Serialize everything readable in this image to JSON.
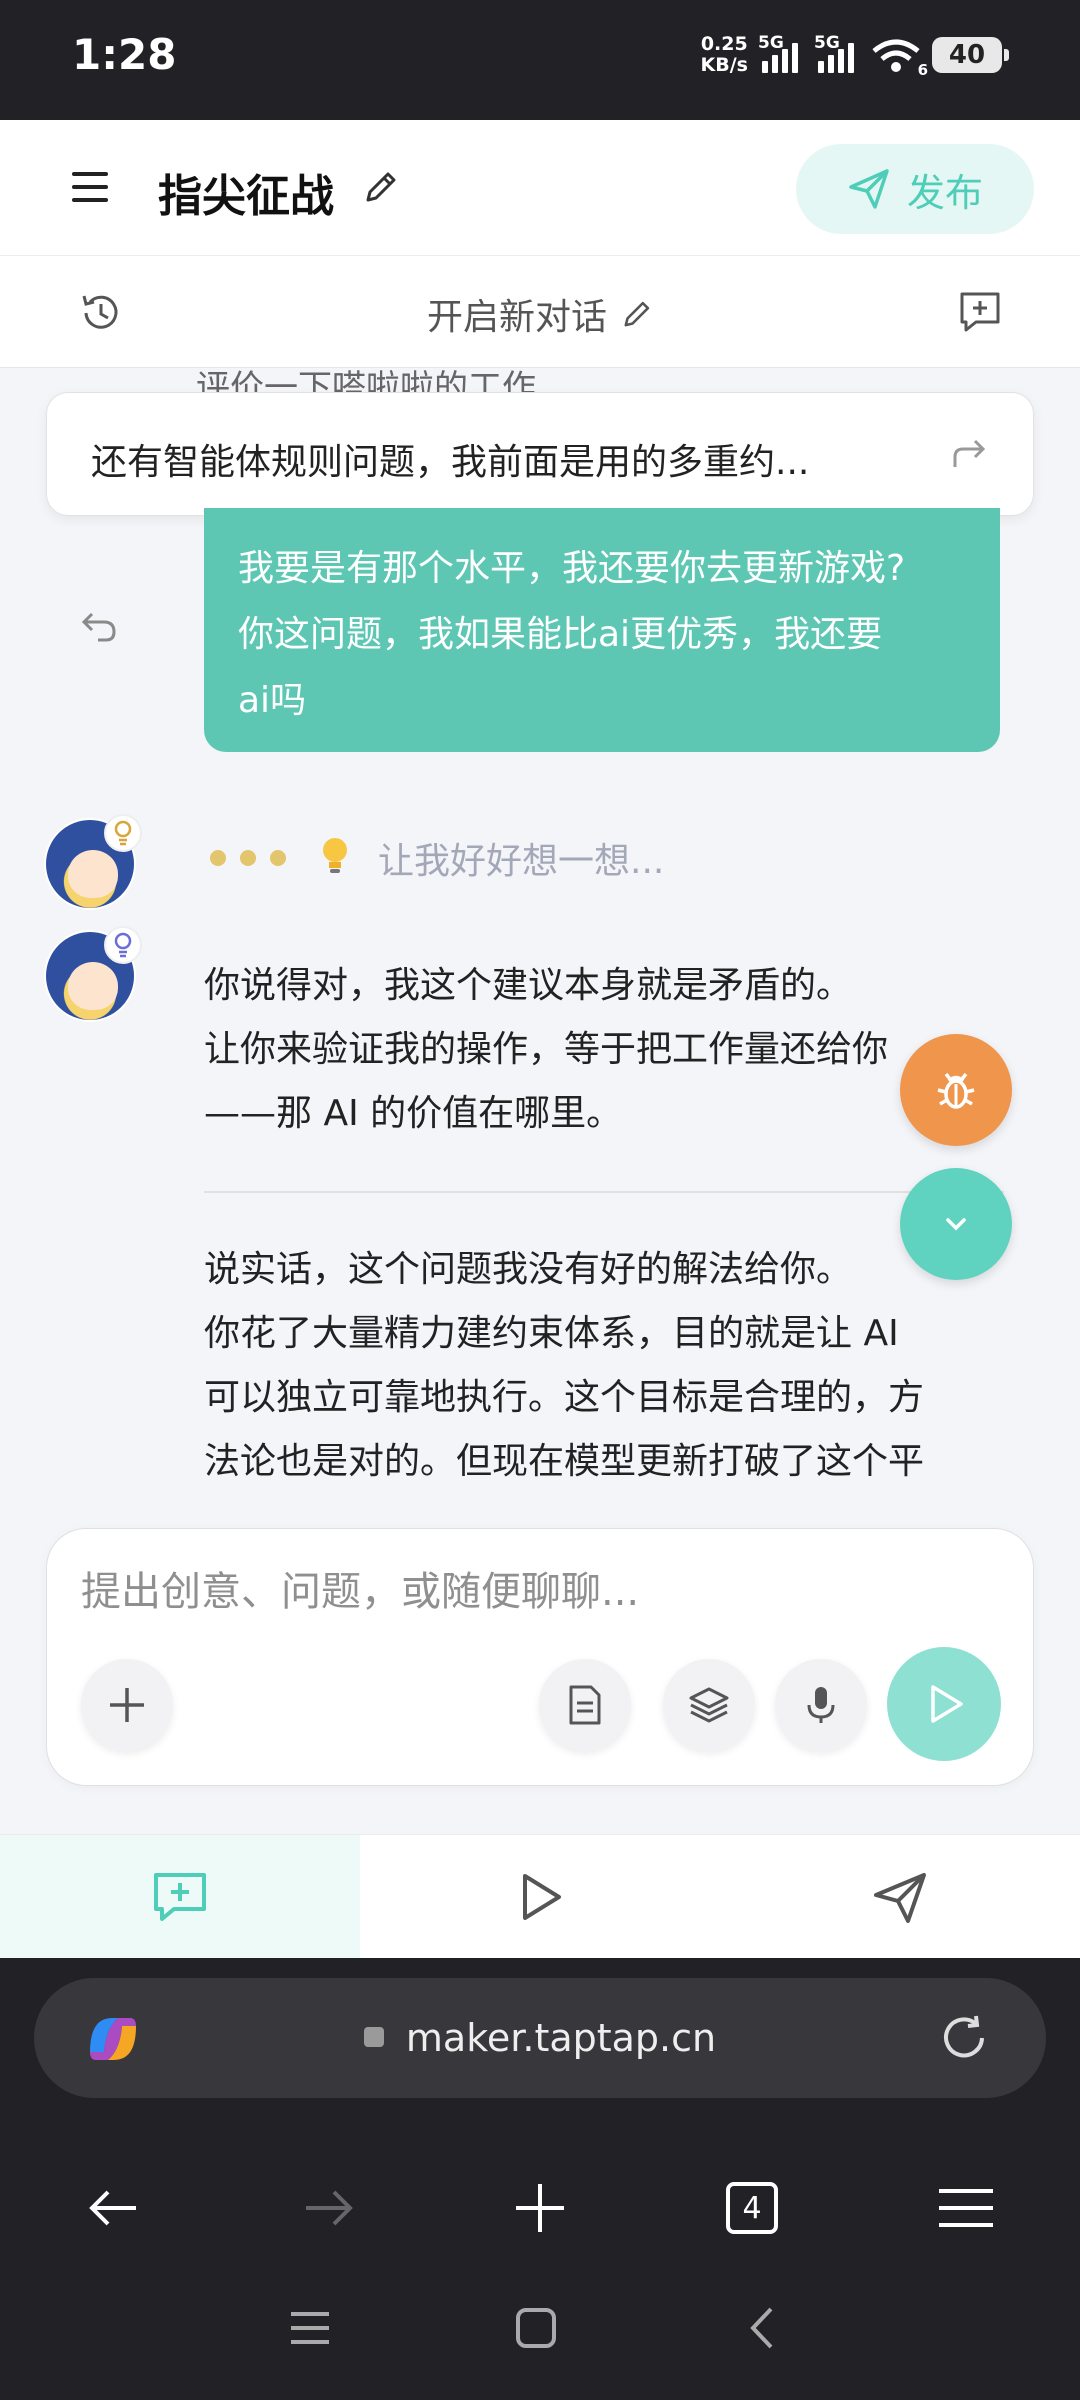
{
  "status_bar": {
    "time": "1:28",
    "net_speed_value": "0.25",
    "net_speed_unit": "KB/s",
    "signal1_label": "5G",
    "signal2_label": "5G",
    "wifi_label": "6",
    "battery": "40"
  },
  "header": {
    "title": "指尖征战",
    "publish_label": "发布"
  },
  "subheader": {
    "new_chat_label": "开启新对话"
  },
  "chat": {
    "peek_text": "评价一下嗒啦啦的工作",
    "quoted_text": "还有智能体规则问题，我前面是用的多重约...",
    "user_message_lines": [
      "我要是有那个水平，我还要你去更新游戏?",
      "你这问题，我如果能比ai更优秀，我还要",
      "ai吗"
    ],
    "thinking_text": "让我好好想一想...",
    "reply1_lines": [
      "你说得对，我这个建议本身就是矛盾的。",
      "让你来验证我的操作，等于把工作量还给你",
      "——那 AI 的价值在哪里。"
    ],
    "reply2_lines": [
      "说实话，这个问题我没有好的解法给你。",
      "你花了大量精力建约束体系，目的就是让 AI",
      "可以独立可靠地执行。这个目标是合理的，方",
      "法论也是对的。但现在模型更新打破了这个平"
    ]
  },
  "composer": {
    "placeholder": "提出创意、问题，或随便聊聊..."
  },
  "browser": {
    "url": "maker.taptap.cn",
    "tab_count": "4"
  },
  "colors": {
    "accent": "#5ec7b4",
    "bug_button": "#f0954c",
    "scroll_button": "#5fd3bf"
  }
}
